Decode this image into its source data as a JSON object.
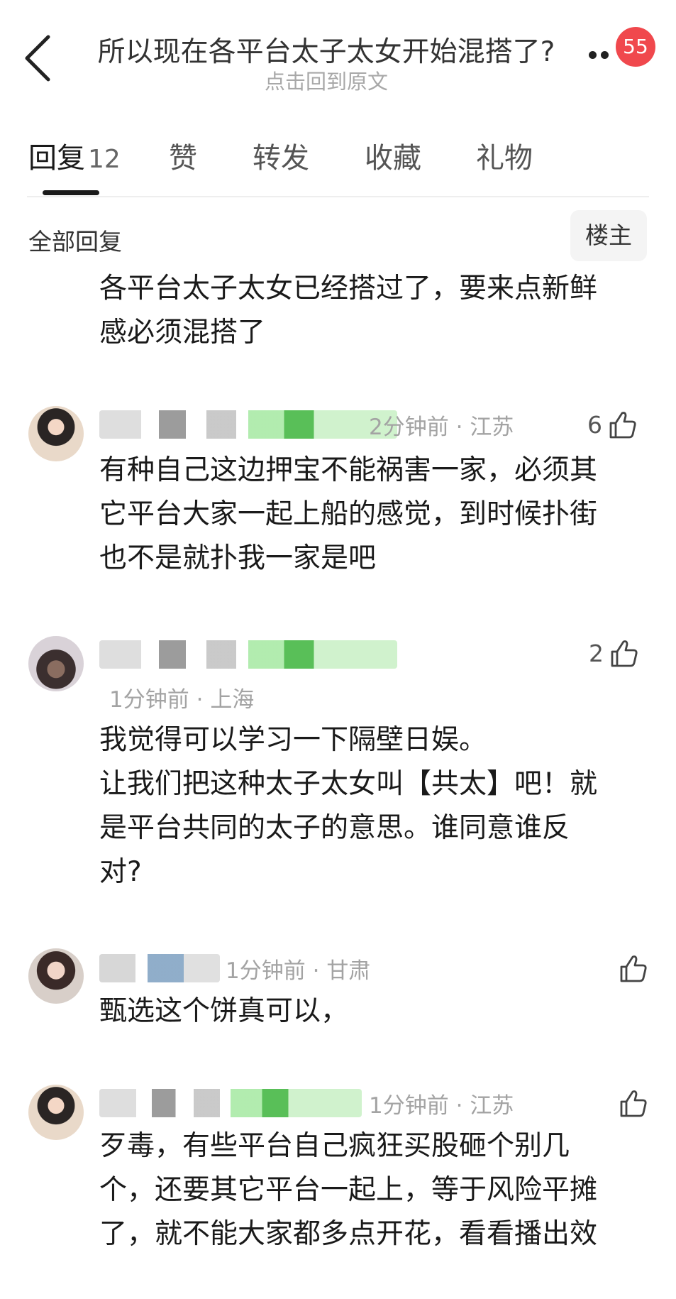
{
  "header": {
    "title": "所以现在各平台太子太女开始混搭了?",
    "subtitle": "点击回到原文",
    "badge_count": "55"
  },
  "tabs": [
    {
      "label": "回复",
      "count": "12",
      "active": true
    },
    {
      "label": "赞",
      "count": ""
    },
    {
      "label": "转发",
      "count": ""
    },
    {
      "label": "收藏",
      "count": ""
    },
    {
      "label": "礼物",
      "count": ""
    }
  ],
  "filter": {
    "label": "全部回复",
    "op_button": "楼主"
  },
  "comments": [
    {
      "text": "各平台太子太女已经搭过了，要来点新鲜\n感必须混搭了"
    },
    {
      "time": "2分钟前",
      "location": "江苏",
      "likes": "6",
      "text": "有种自己这边押宝不能祸害一家，必须其\n它平台大家一起上船的感觉，到时候扑街\n也不是就扑我一家是吧"
    },
    {
      "time": "1分钟前",
      "location": "上海",
      "likes": "2",
      "text": "我觉得可以学习一下隔壁日娱。\n让我们把这种太子太女叫【共太】吧！就\n是平台共同的太子的意思。谁同意谁反\n对?"
    },
    {
      "time": "1分钟前",
      "location": "甘肃",
      "likes": "",
      "text": "甄选这个饼真可以，"
    },
    {
      "time": "1分钟前",
      "location": "江苏",
      "likes": "",
      "text": "歹毒，有些平台自己疯狂买股砸个别几\n个，还要其它平台一起上，等于风险平摊\n了，就不能大家都多点开花，看看播出效"
    }
  ],
  "meta_separator": "·",
  "colors": {
    "badge": "#f0484d",
    "meta_text": "#a3a3a3",
    "tab_active": "#1a1a1a"
  },
  "icons": {
    "back": "chevron-left-icon",
    "more": "more-dots-icon",
    "like": "thumbs-up-icon"
  }
}
